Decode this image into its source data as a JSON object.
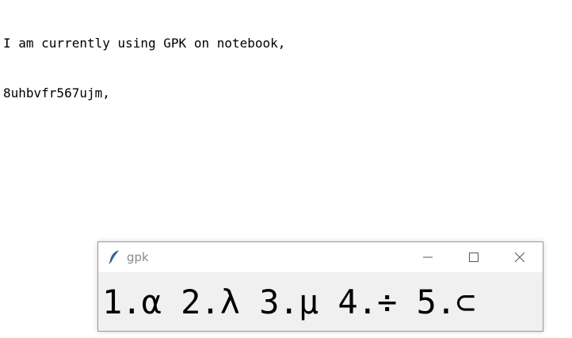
{
  "editor": {
    "lines": [
      "I am currently using GPK on notebook,",
      "8uhbvfr567ujm,"
    ]
  },
  "window": {
    "title": "gpk",
    "icon": "feather-icon",
    "candidates": "1.α 2.λ 3.μ 4.÷ 5.⊂"
  },
  "colors": {
    "title_text": "#8a8a8a",
    "window_body": "#f0f0f0",
    "titlebar": "#ffffff"
  }
}
